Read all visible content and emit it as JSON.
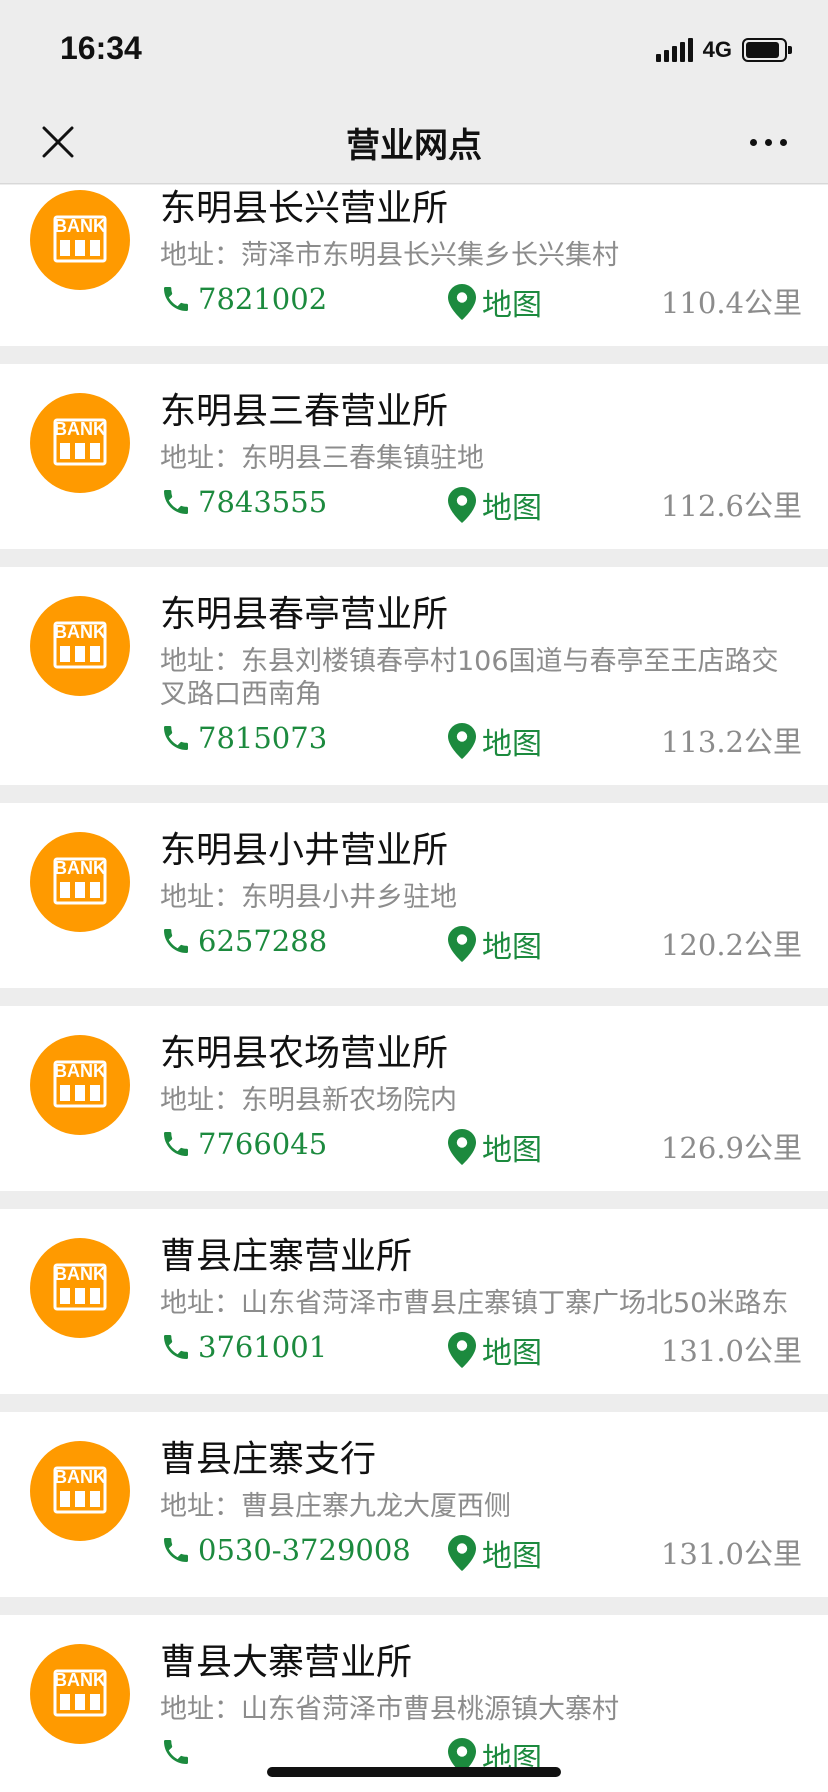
{
  "status_bar": {
    "time": "16:34",
    "network": "4G",
    "battery_percent": 80
  },
  "nav": {
    "title": "营业网点",
    "close_icon": "close-icon",
    "more_icon": "more-dots-icon"
  },
  "icons": {
    "bank_logo": "bank-icon",
    "bank_logo_text": "BANK",
    "phone": "phone-icon",
    "map": "map-pin-icon"
  },
  "colors": {
    "accent_green": "#1c8a3e",
    "bank_orange": "#ff9a00",
    "muted_gray": "#8c8c8c"
  },
  "map_label": "地图",
  "branches": [
    {
      "name": "东明县长兴营业所",
      "address": "地址：菏泽市东明县长兴集乡长兴集村",
      "phone": "7821002",
      "distance": "110.4公里"
    },
    {
      "name": "东明县三春营业所",
      "address": "地址：东明县三春集镇驻地",
      "phone": "7843555",
      "distance": "112.6公里"
    },
    {
      "name": "东明县春亭营业所",
      "address": "地址：东县刘楼镇春亭村106国道与春亭至王店路交叉路口西南角",
      "phone": "7815073",
      "distance": "113.2公里"
    },
    {
      "name": "东明县小井营业所",
      "address": "地址：东明县小井乡驻地",
      "phone": "6257288",
      "distance": "120.2公里"
    },
    {
      "name": "东明县农场营业所",
      "address": "地址：东明县新农场院内",
      "phone": "7766045",
      "distance": "126.9公里"
    },
    {
      "name": "曹县庄寨营业所",
      "address": "地址：山东省菏泽市曹县庄寨镇丁寨广场北50米路东",
      "phone": "3761001",
      "distance": "131.0公里"
    },
    {
      "name": "曹县庄寨支行",
      "address": "地址：曹县庄寨九龙大厦西侧",
      "phone": "0530-3729008",
      "distance": "131.0公里"
    },
    {
      "name": "曹县大寨营业所",
      "address": "地址：山东省菏泽市曹县桃源镇大寨村",
      "phone": "",
      "distance": ""
    }
  ]
}
